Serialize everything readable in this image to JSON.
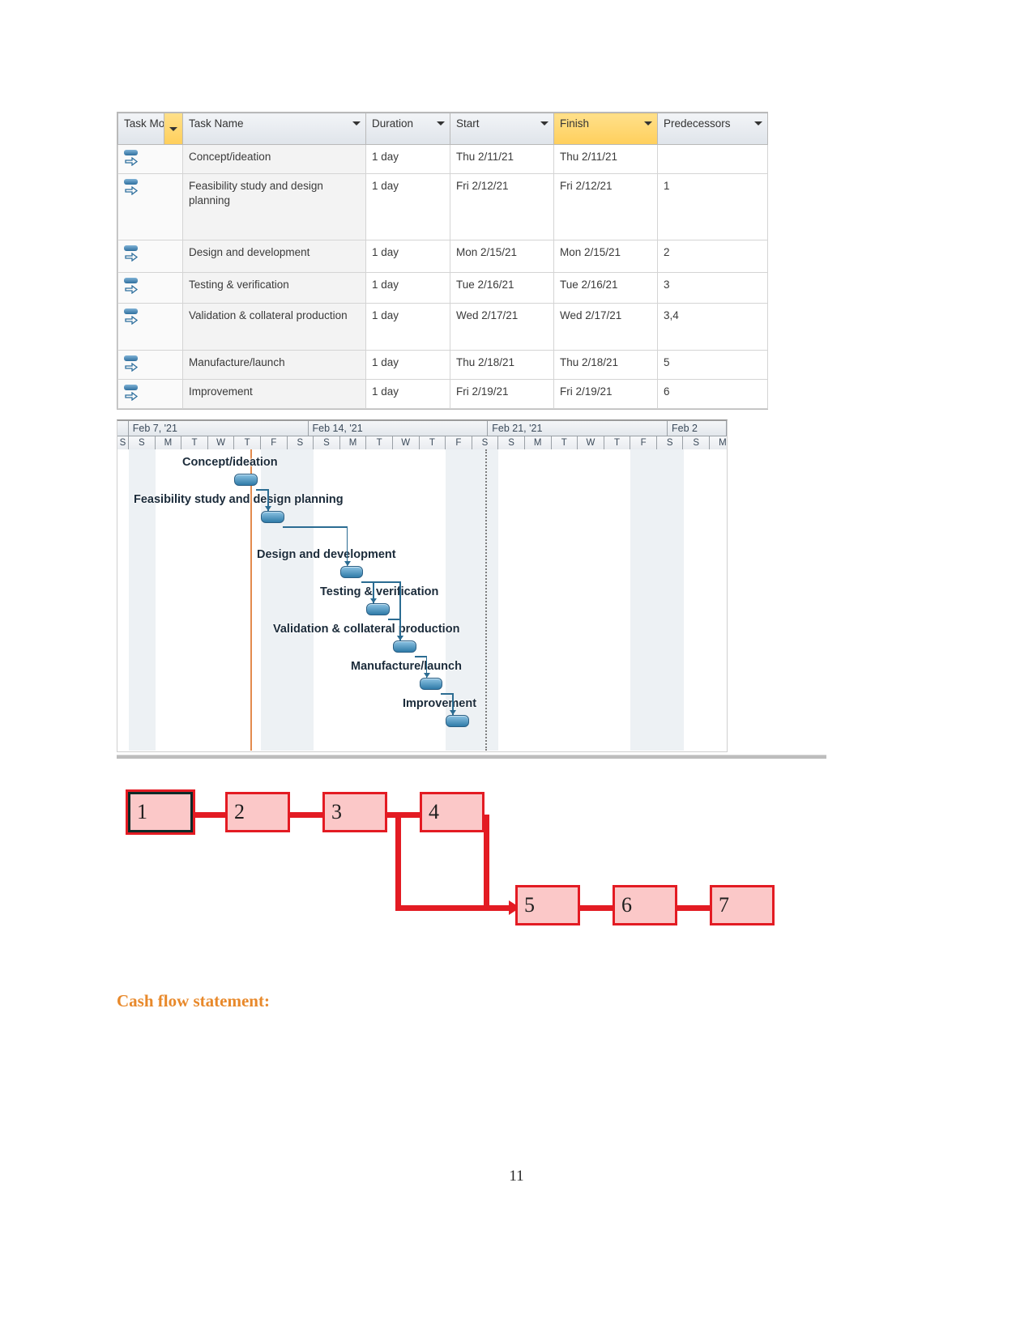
{
  "task_table": {
    "columns": [
      {
        "key": "mode",
        "label": "Task Mode"
      },
      {
        "key": "name",
        "label": "Task Name"
      },
      {
        "key": "duration",
        "label": "Duration"
      },
      {
        "key": "start",
        "label": "Start"
      },
      {
        "key": "finish",
        "label": "Finish"
      },
      {
        "key": "predecessors",
        "label": "Predecessors"
      }
    ],
    "highlight_column": "Finish",
    "highlight_color": "#ffcf5c",
    "rows": [
      {
        "mode_icon": "manually-scheduled-icon",
        "name": "Concept/ideation",
        "duration": "1 day",
        "start": "Thu 2/11/21",
        "finish": "Thu 2/11/21",
        "predecessors": ""
      },
      {
        "mode_icon": "manually-scheduled-icon",
        "name": "Feasibility study and design planning",
        "duration": "1 day",
        "start": "Fri 2/12/21",
        "finish": "Fri 2/12/21",
        "predecessors": "1"
      },
      {
        "mode_icon": "manually-scheduled-icon",
        "name": "Design and development",
        "duration": "1 day",
        "start": "Mon 2/15/21",
        "finish": "Mon 2/15/21",
        "predecessors": "2"
      },
      {
        "mode_icon": "manually-scheduled-icon",
        "name": "Testing & verification",
        "duration": "1 day",
        "start": "Tue 2/16/21",
        "finish": "Tue 2/16/21",
        "predecessors": "3"
      },
      {
        "mode_icon": "manually-scheduled-icon",
        "name": "Validation & collateral production",
        "duration": "1 day",
        "start": "Wed 2/17/21",
        "finish": "Wed 2/17/21",
        "predecessors": "3,4"
      },
      {
        "mode_icon": "manually-scheduled-icon",
        "name": "Manufacture/launch",
        "duration": "1 day",
        "start": "Thu 2/18/21",
        "finish": "Thu 2/18/21",
        "predecessors": "5"
      },
      {
        "mode_icon": "manually-scheduled-icon",
        "name": "Improvement",
        "duration": "1 day",
        "start": "Fri 2/19/21",
        "finish": "Fri 2/19/21",
        "predecessors": "6"
      }
    ]
  },
  "gantt": {
    "weeks": [
      "Feb 7, '21",
      "Feb 14, '21",
      "Feb 21, '21",
      "Feb 2"
    ],
    "leading_day": "S",
    "day_letters": [
      "S",
      "M",
      "T",
      "W",
      "T",
      "F",
      "S"
    ],
    "bars": [
      {
        "label": "Concept/ideation",
        "start_day_index": 4,
        "duration_days": 1
      },
      {
        "label": "Feasibility study and design planning",
        "start_day_index": 5,
        "duration_days": 1
      },
      {
        "label": "Design and development",
        "start_day_index": 8,
        "duration_days": 1
      },
      {
        "label": "Testing & verification",
        "start_day_index": 9,
        "duration_days": 1
      },
      {
        "label": "Validation & collateral production",
        "start_day_index": 10,
        "duration_days": 1
      },
      {
        "label": "Manufacture/launch",
        "start_day_index": 11,
        "duration_days": 1
      },
      {
        "label": "Improvement",
        "start_day_index": 12,
        "duration_days": 1
      }
    ]
  },
  "network": {
    "nodes": [
      "1",
      "2",
      "3",
      "4",
      "5",
      "6",
      "7"
    ],
    "start_node": "1",
    "node_fill": "#fbc8c8",
    "node_border": "#e31b23",
    "edges": [
      {
        "from": "1",
        "to": "2"
      },
      {
        "from": "2",
        "to": "3"
      },
      {
        "from": "3",
        "to": "4"
      },
      {
        "from": "3",
        "to": "5"
      },
      {
        "from": "4",
        "to": "5"
      },
      {
        "from": "5",
        "to": "6"
      },
      {
        "from": "6",
        "to": "7"
      }
    ]
  },
  "headings": {
    "cash_flow": "Cash flow statement:"
  },
  "page_number": "11"
}
